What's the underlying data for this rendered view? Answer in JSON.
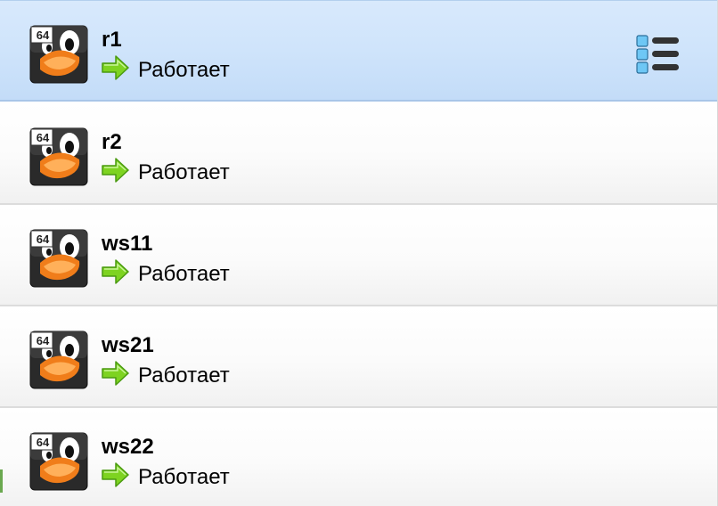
{
  "vm_list": {
    "items": [
      {
        "name": "r1",
        "state": "Работает",
        "os_badge": "64",
        "selected": true
      },
      {
        "name": "r2",
        "state": "Работает",
        "os_badge": "64",
        "selected": false
      },
      {
        "name": "ws11",
        "state": "Работает",
        "os_badge": "64",
        "selected": false
      },
      {
        "name": "ws21",
        "state": "Работает",
        "os_badge": "64",
        "selected": false
      },
      {
        "name": "ws22",
        "state": "Работает",
        "os_badge": "64",
        "selected": false
      }
    ],
    "icons": {
      "os": "linux-64-penguin-icon",
      "state": "running-arrow-icon",
      "details": "details-menu-icon"
    },
    "colors": {
      "selected_bg": "#cfe4fb",
      "running_arrow": "#7ed321",
      "beak": "#f07d1a"
    }
  }
}
